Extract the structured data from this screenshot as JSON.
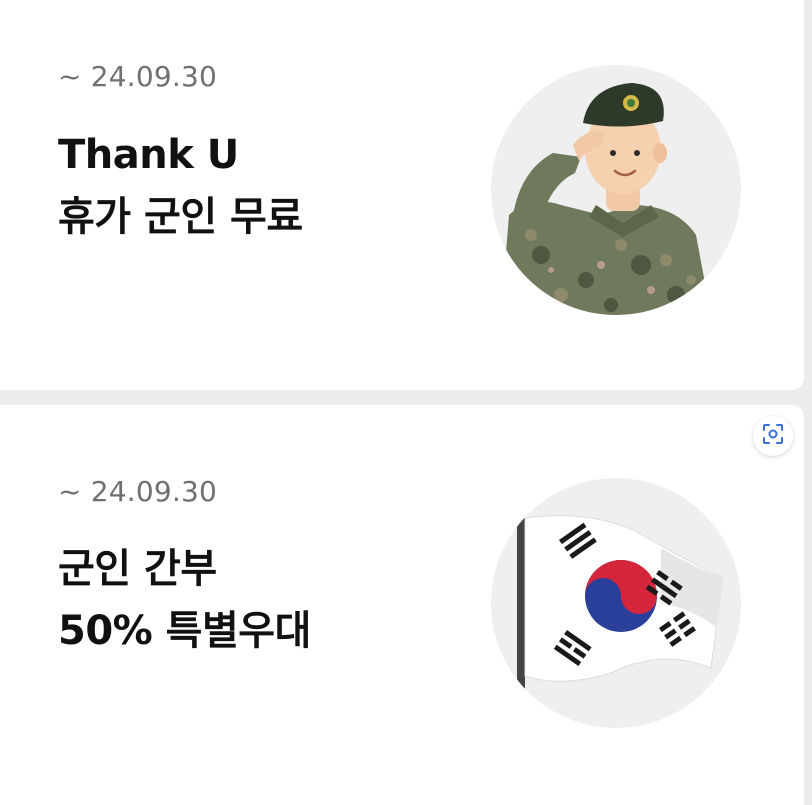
{
  "promotions": [
    {
      "period": "~ 24.09.30",
      "title_line1": "Thank U",
      "title_line2": "휴가 군인 무료",
      "image_icon": "saluting-soldier-illustration"
    },
    {
      "period": "~ 24.09.30",
      "title_line1": "군인 간부",
      "title_line2": "50% 특별우대",
      "image_icon": "korean-flag-illustration"
    }
  ],
  "floating_actions": {
    "lens_icon": "visual-search-icon"
  },
  "colors": {
    "background": "#ececec",
    "card": "#ffffff",
    "date_text": "#707070",
    "title_text": "#111111",
    "thumb_bg": "#efefef"
  }
}
